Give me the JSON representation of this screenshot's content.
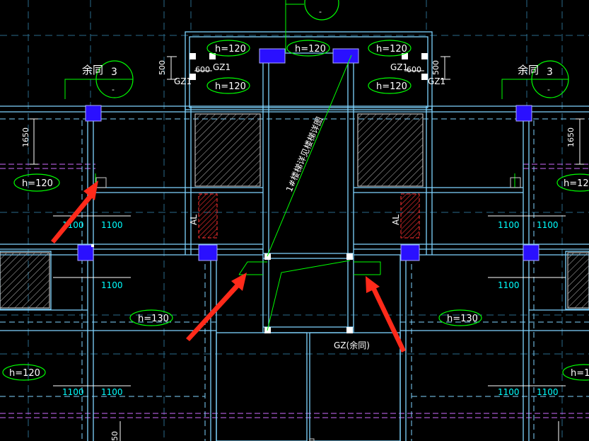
{
  "labels": {
    "slab_h120": "h=120",
    "slab_h130": "h=130",
    "gz1": "GZ1",
    "gz_same": "GZ(余同)",
    "yu_tong": "余同",
    "axis_3": "3",
    "axis_dash": "-",
    "dim_500": "500",
    "dim_600": "600",
    "dim_1650": "1650",
    "dim_1100": "1100",
    "dim_50": "50",
    "al": "AL",
    "stair_note": "1#楼梯详见楼梯详图"
  },
  "colors": {
    "background": "#000000",
    "wall": "#7fd4ff",
    "slab_ellipse": "#00ff00",
    "dim_text": "#00ffff",
    "column": "#1a10ff",
    "hatch_red": "#ff3030",
    "arrow": "#ff2a1a",
    "grid_dash": "#d06cff"
  },
  "icons": [
    "column-square",
    "hatched-shaft",
    "red-arrow",
    "axis-bubble"
  ]
}
